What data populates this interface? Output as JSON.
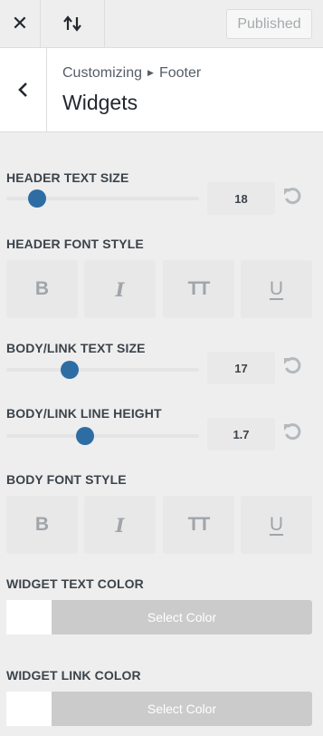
{
  "topbar": {
    "close_icon": "close-icon",
    "sort_icon": "reorder-arrows-icon",
    "publish_label": "Published"
  },
  "section": {
    "back_icon": "chevron-left-icon",
    "breadcrumb_root": "Customizing",
    "breadcrumb_child": "Footer",
    "title": "Widgets"
  },
  "controls": {
    "header_text_size": {
      "label": "HEADER TEXT SIZE",
      "value": "18",
      "slider_fraction": 0.16
    },
    "header_font_style": {
      "label": "HEADER FONT STYLE",
      "buttons": [
        "B",
        "I",
        "TT",
        "U"
      ]
    },
    "body_text_size": {
      "label": "BODY/LINK TEXT SIZE",
      "value": "17",
      "slider_fraction": 0.33
    },
    "body_line_height": {
      "label": "BODY/LINK LINE HEIGHT",
      "value": "1.7",
      "slider_fraction": 0.41
    },
    "body_font_style": {
      "label": "BODY FONT STYLE",
      "buttons": [
        "B",
        "I",
        "TT",
        "U"
      ]
    },
    "widget_text_color": {
      "label": "WIDGET TEXT COLOR",
      "button": "Select Color"
    },
    "widget_link_color": {
      "label": "WIDGET LINK COLOR",
      "button": "Select Color"
    }
  },
  "colors": {
    "slider_knob": "#2e6da4",
    "select_color_bg": "#cbcbcb"
  }
}
